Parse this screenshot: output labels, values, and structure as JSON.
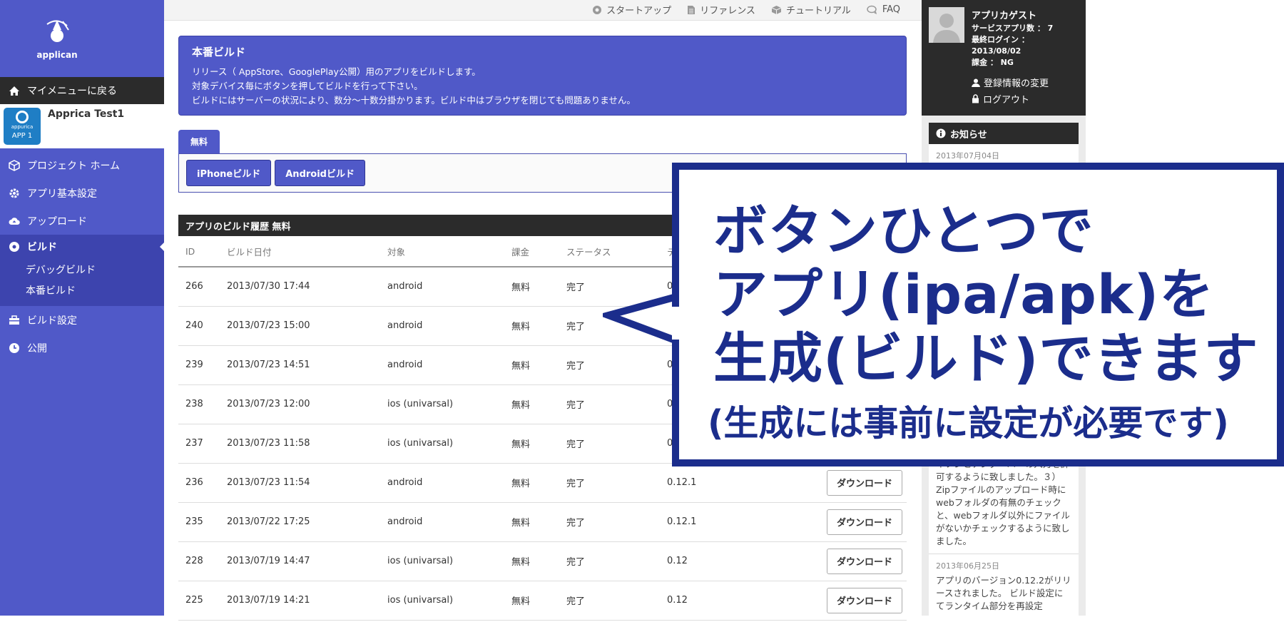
{
  "logo": {
    "text": "applican"
  },
  "sidebar": {
    "back_label": "マイメニューに戻る",
    "app": {
      "name": "Apprica Test1",
      "icon_small": "appurica",
      "icon_code": "APP 1"
    },
    "items": [
      {
        "label": "プロジェクト ホーム",
        "icon": "cube-icon"
      },
      {
        "label": "アプリ基本設定",
        "icon": "gear-icon"
      },
      {
        "label": "アップロード",
        "icon": "cloud-upload-icon"
      },
      {
        "label": "ビルド",
        "icon": "disc-icon"
      },
      {
        "label": "ビルド設定",
        "icon": "toolbox-icon"
      },
      {
        "label": "公開",
        "icon": "clock-icon"
      }
    ],
    "sub_items": [
      "デバッグビルド",
      "本番ビルド"
    ]
  },
  "top_links": [
    {
      "label": "スタートアップ",
      "icon": "puzzle-icon"
    },
    {
      "label": "リファレンス",
      "icon": "document-icon"
    },
    {
      "label": "チュートリアル",
      "icon": "box-icon"
    },
    {
      "label": "FAQ",
      "icon": "chat-icon"
    }
  ],
  "info": {
    "title": "本番ビルド",
    "lines": [
      "リリース（ AppStore、GooglePlay公開）用のアプリをビルドします。",
      "対象デバイス毎にボタンを押してビルドを行って下さい。",
      "ビルドにはサーバーの状況により、数分～十数分掛かります。ビルド中はブラウザを閉じても問題ありません。"
    ]
  },
  "tab": {
    "label": "無料"
  },
  "build_buttons": {
    "iphone": "iPhoneビルド",
    "android": "Androidビルド"
  },
  "history": {
    "title": "アプリのビルド履歴 無料",
    "columns": [
      "ID",
      "ビルド日付",
      "対象",
      "課金",
      "ステータス",
      "テ"
    ],
    "download_label": "ダウンロード",
    "rows": [
      {
        "id": "266",
        "date": "2013/07/30 17:44",
        "target": "android",
        "charge": "無料",
        "status": "完了",
        "ver": "0",
        "download": false
      },
      {
        "id": "240",
        "date": "2013/07/23 15:00",
        "target": "android",
        "charge": "無料",
        "status": "完了",
        "ver": "",
        "download": false
      },
      {
        "id": "239",
        "date": "2013/07/23 14:51",
        "target": "android",
        "charge": "無料",
        "status": "完了",
        "ver": "0",
        "download": false
      },
      {
        "id": "238",
        "date": "2013/07/23 12:00",
        "target": "ios (univarsal)",
        "charge": "無料",
        "status": "完了",
        "ver": "0",
        "download": false
      },
      {
        "id": "237",
        "date": "2013/07/23 11:58",
        "target": "ios (univarsal)",
        "charge": "無料",
        "status": "完了",
        "ver": "0",
        "download": false
      },
      {
        "id": "236",
        "date": "2013/07/23 11:54",
        "target": "android",
        "charge": "無料",
        "status": "完了",
        "ver": "0.12.1",
        "download": true
      },
      {
        "id": "235",
        "date": "2013/07/22 17:25",
        "target": "android",
        "charge": "無料",
        "status": "完了",
        "ver": "0.12.1",
        "download": true
      },
      {
        "id": "228",
        "date": "2013/07/19 14:47",
        "target": "ios (univarsal)",
        "charge": "無料",
        "status": "完了",
        "ver": "0.12",
        "download": true
      },
      {
        "id": "225",
        "date": "2013/07/19 14:21",
        "target": "ios (univarsal)",
        "charge": "無料",
        "status": "完了",
        "ver": "0.12",
        "download": true
      }
    ]
  },
  "user": {
    "name": "アプリカゲスト",
    "service_count": "サービスアプリ数 ： 7",
    "last_login_label": "最終ログイン ：",
    "last_login_date": "2013/08/02",
    "billing": "課金 ： NG",
    "edit_label": "登録情報の変更",
    "logout_label": "ログアウト"
  },
  "news": {
    "title": "お知らせ",
    "items": [
      {
        "date": "2013年07月04日",
        "body": ""
      },
      {
        "date": "",
        "body": "イフンとアンダーバーの入力を許可するように致しました。３）Zipファイルのアップロード時にwebフォルダの有無のチェックと、webフォルダ以外にファイルがないかチェックするように致しました。"
      },
      {
        "date": "2013年06月25日",
        "body": "アプリのバージョン0.12.2がリリースされました。 ビルド設定にてランタイム部分を再設定"
      }
    ]
  },
  "callout": {
    "line1": "ボタンひとつで",
    "line2": "アプリ(ipa/apk)を",
    "line3": "生成(ビルド)できます",
    "line4": "(生成には事前に設定が必要です)",
    "border_color": "#1b2d8c"
  }
}
